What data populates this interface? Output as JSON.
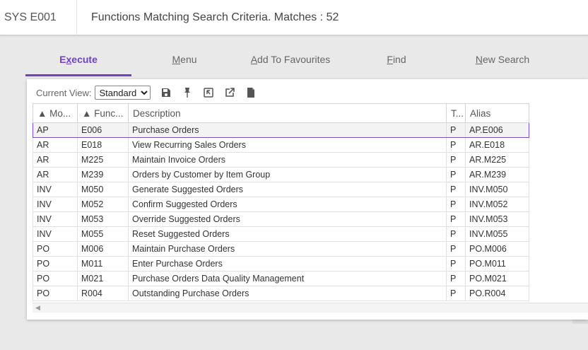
{
  "header": {
    "code": "SYS E001",
    "title": "Functions Matching Search Criteria. Matches : 52"
  },
  "tabs": [
    {
      "label_pre": "E",
      "label_ul": "x",
      "label_post": "ecute",
      "active": true
    },
    {
      "label_pre": "",
      "label_ul": "M",
      "label_post": "enu",
      "active": false
    },
    {
      "label_pre": "",
      "label_ul": "A",
      "label_post": "dd To Favourites",
      "active": false
    },
    {
      "label_pre": "",
      "label_ul": "F",
      "label_post": "ind",
      "active": false
    },
    {
      "label_pre": "",
      "label_ul": "N",
      "label_post": "ew Search",
      "active": false
    }
  ],
  "toolbar": {
    "current_view_label": "Current View:",
    "view_selected": "Standard",
    "icons": [
      "save-icon",
      "pin-icon",
      "restore-icon",
      "export-icon",
      "document-icon"
    ]
  },
  "grid": {
    "columns": [
      "▲ Mo...",
      "▲ Func...",
      "Description",
      "T...",
      "Alias"
    ],
    "rows": [
      [
        "AP",
        "E006",
        "Purchase Orders",
        "P",
        "AP.E006"
      ],
      [
        "AR",
        "E018",
        "View Recurring Sales Orders",
        "P",
        "AR.E018"
      ],
      [
        "AR",
        "M225",
        "Maintain Invoice Orders",
        "P",
        "AR.M225"
      ],
      [
        "AR",
        "M239",
        "Orders by Customer by Item Group",
        "P",
        "AR.M239"
      ],
      [
        "INV",
        "M050",
        "Generate Suggested Orders",
        "P",
        "INV.M050"
      ],
      [
        "INV",
        "M052",
        "Confirm Suggested Orders",
        "P",
        "INV.M052"
      ],
      [
        "INV",
        "M053",
        "Override Suggested Orders",
        "P",
        "INV.M053"
      ],
      [
        "INV",
        "M055",
        "Reset Suggested Orders",
        "P",
        "INV.M055"
      ],
      [
        "PO",
        "M006",
        "Maintain Purchase Orders",
        "P",
        "PO.M006"
      ],
      [
        "PO",
        "M011",
        "Enter Purchase Orders",
        "P",
        "PO.M011"
      ],
      [
        "PO",
        "M021",
        "Purchase Orders Data Quality Management",
        "P",
        "PO.M021"
      ],
      [
        "PO",
        "R004",
        "Outstanding Purchase Orders",
        "P",
        "PO.R004"
      ]
    ],
    "selected_row": 0
  },
  "colors": {
    "accent": "#6f42c1",
    "selection_border": "#7a4fc0"
  }
}
